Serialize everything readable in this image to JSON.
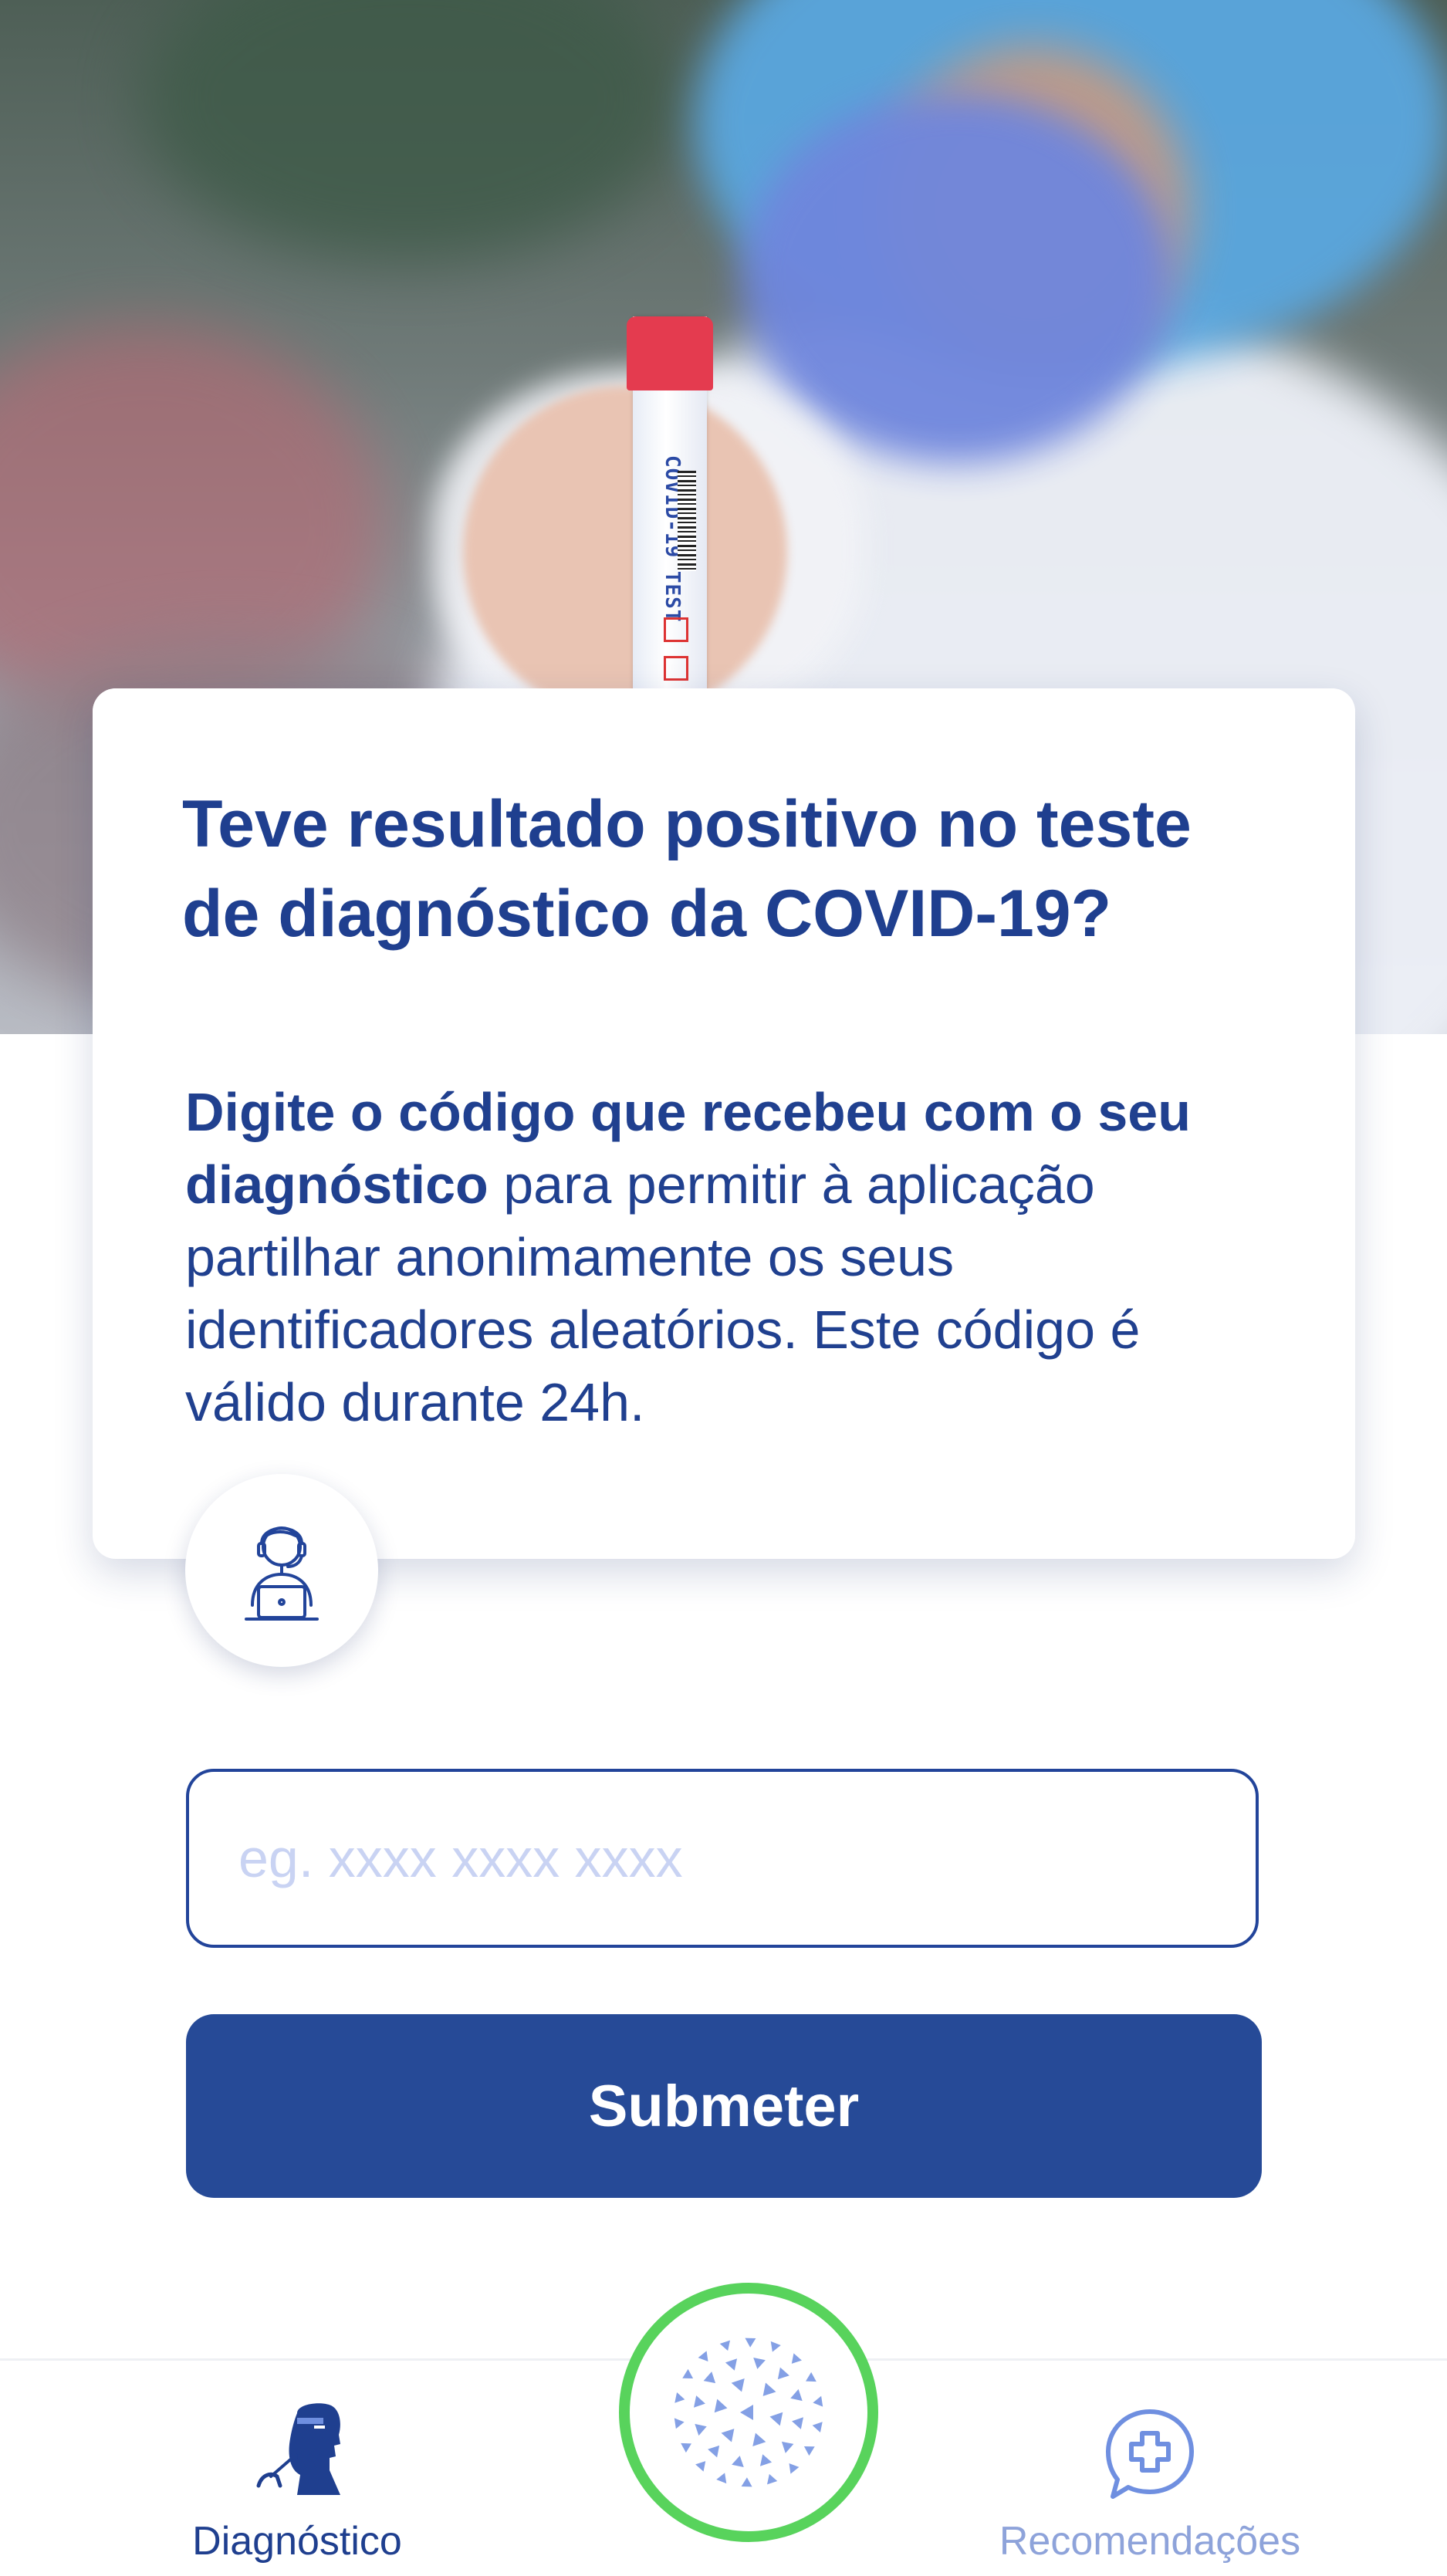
{
  "card": {
    "title": "Teve resultado positivo no teste de diagnóstico da COVID-19?",
    "body_bold": "Digite o código que recebeu com o seu diagnóstico",
    "body_rest": " para permitir à aplicação partilhar anonimamente os seus identificadores aleatórios. Este código é válido durante 24h."
  },
  "hero": {
    "tube_label": "COVID-19 TEST"
  },
  "form": {
    "code_placeholder": "eg. xxxx xxxx xxxx",
    "code_value": "",
    "submit_label": "Submeter"
  },
  "nav": {
    "items": [
      {
        "label": "Diagnóstico",
        "active": true,
        "icon": "doctor-swab-icon"
      },
      {
        "label": "Recomendações",
        "active": false,
        "icon": "medical-chat-icon"
      }
    ],
    "center_icon": "virus-dots-icon"
  },
  "colors": {
    "primary": "#264a97",
    "title": "#1f3f8f",
    "placeholder": "#c9d3f3",
    "inactive_nav": "#8ea3da",
    "center_ring": "#58d35c"
  }
}
